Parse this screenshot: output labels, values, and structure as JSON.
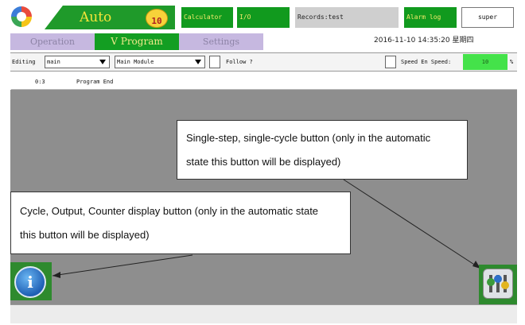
{
  "header": {
    "mode": "Auto",
    "speed_level": "10",
    "buttons": {
      "calculator": "Calculator",
      "io": "I/O",
      "records": "Records:test",
      "alarm": "Alarm log"
    },
    "user": "super"
  },
  "tabs": [
    "Operation",
    "V Program",
    "Settings"
  ],
  "active_tab": "V Program",
  "datetime": "2016-11-10  14:35:20  星期四",
  "editing": {
    "label": "Editing",
    "program": "main",
    "module": "Main Module",
    "follow_label": "Follow ?",
    "speed_label": "Speed En Speed:",
    "speed_value": "10",
    "speed_unit": "%"
  },
  "program_lines": [
    {
      "line": "0:3",
      "text": "Program End"
    }
  ],
  "callouts": {
    "top": [
      "Single-step, single-cycle button (only in the automatic",
      "state this button will be displayed)"
    ],
    "left": [
      "Cycle, Output, Counter display button (only in the automatic state",
      "this button will be displayed)"
    ]
  },
  "info_glyph": "i",
  "icons": {
    "logo": "app-logo-icon",
    "info": "info-icon",
    "step": "sliders-icon"
  },
  "colors": {
    "accent_green": "#119a1e",
    "tab_inactive": "#c6b8e0",
    "speed_green": "#44e24a"
  }
}
